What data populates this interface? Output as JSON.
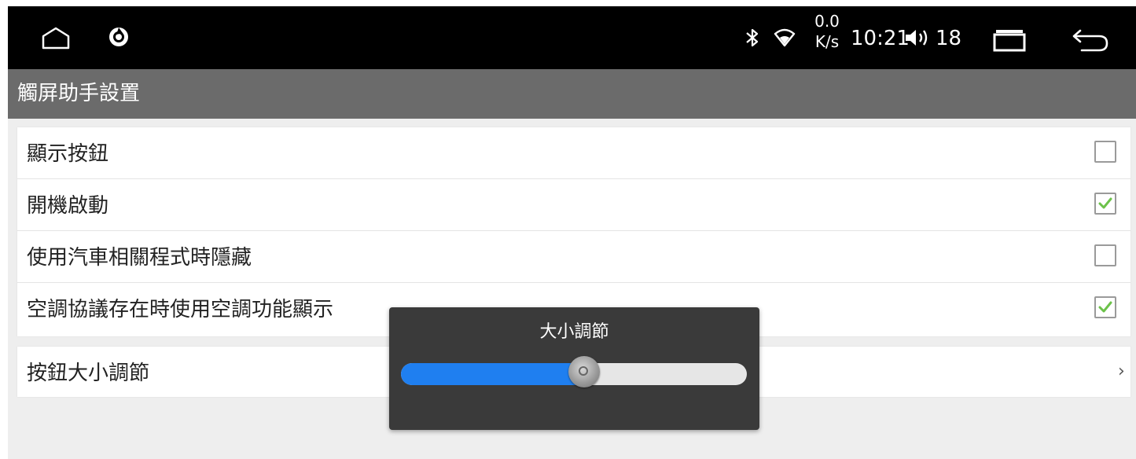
{
  "status_bar": {
    "net_speed_value": "0.0",
    "net_speed_unit": "K/s",
    "time": "10:21",
    "volume": "18",
    "icons": [
      "home-icon",
      "app-icon",
      "bluetooth-icon",
      "wifi-icon",
      "volume-icon",
      "recent-apps-icon",
      "back-icon"
    ]
  },
  "titlebar": {
    "title": "觸屏助手設置"
  },
  "settings": {
    "items": [
      {
        "label": "顯示按鈕",
        "checked": false
      },
      {
        "label": "開機啟動",
        "checked": true
      },
      {
        "label": "使用汽車相關程式時隱藏",
        "checked": false
      },
      {
        "label": "空調協議存在時使用空調功能顯示",
        "checked": true
      }
    ],
    "size_item": {
      "label": "按鈕大小調節",
      "chevron": "›"
    }
  },
  "dialog": {
    "title": "大小調節",
    "slider_value": 0.53
  },
  "colors": {
    "status_bar": "#000000",
    "title_bar": "#6b6b6b",
    "check": "#6cc24a",
    "slider_fill": "#1f7ff0",
    "dialog_bg": "#3a3a3a"
  }
}
